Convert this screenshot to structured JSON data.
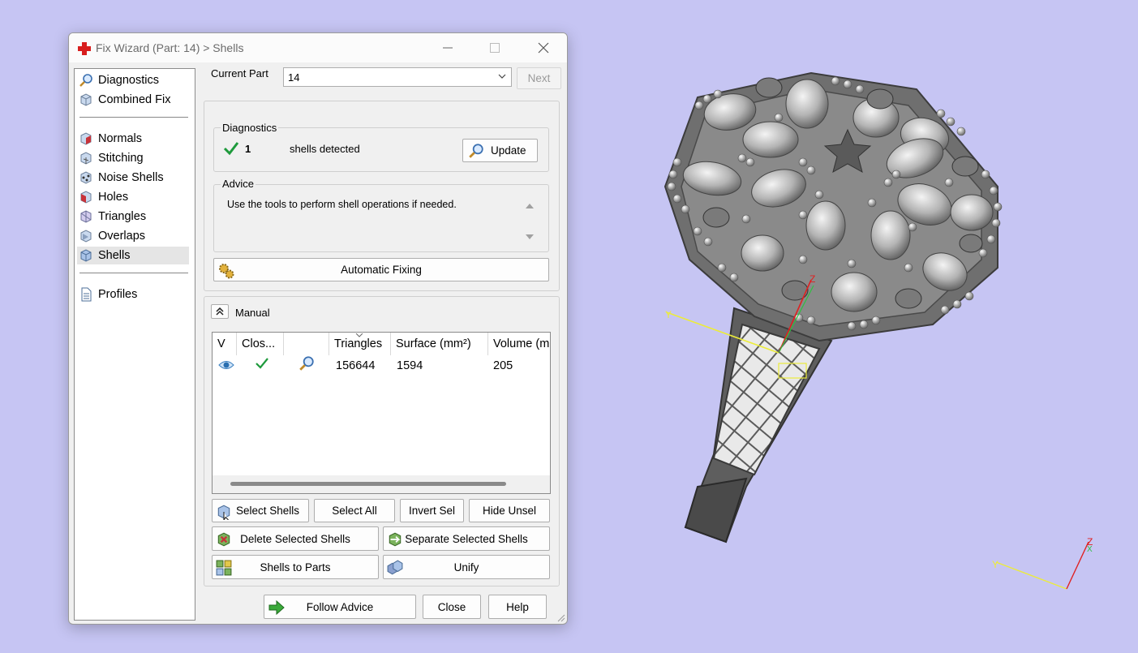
{
  "window": {
    "title": "Fix Wizard (Part: 14) > Shells",
    "controls": [
      "minimize-icon",
      "maximize-icon",
      "close-icon"
    ]
  },
  "sidebar": {
    "items": [
      {
        "label": "Diagnostics",
        "icon": "magnifier-icon"
      },
      {
        "label": "Combined Fix",
        "icon": "cube-icon"
      },
      {
        "label": "Normals",
        "icon": "normals-cube-icon"
      },
      {
        "label": "Stitching",
        "icon": "stitching-cube-icon"
      },
      {
        "label": "Noise Shells",
        "icon": "noise-cube-icon"
      },
      {
        "label": "Holes",
        "icon": "holes-cube-icon"
      },
      {
        "label": "Triangles",
        "icon": "triangles-cube-icon"
      },
      {
        "label": "Overlaps",
        "icon": "overlaps-cube-icon"
      },
      {
        "label": "Shells",
        "icon": "shells-cube-icon",
        "selected": true
      },
      {
        "label": "Profiles",
        "icon": "document-icon"
      }
    ]
  },
  "part": {
    "label": "Current Part",
    "value": "14",
    "next_label": "Next"
  },
  "diagnostics": {
    "title": "Diagnostics",
    "count": "1",
    "text": "shells detected",
    "update_label": "Update",
    "status_color": "#1e9a3c"
  },
  "advice": {
    "title": "Advice",
    "text": "Use the tools to perform shell operations if needed."
  },
  "auto_fix_label": "Automatic Fixing",
  "manual": {
    "label": "Manual",
    "columns": [
      "V",
      "Clos...",
      "",
      "Triangles",
      "Surface (mm²)",
      "Volume (m"
    ],
    "rows": [
      {
        "visible": "eye-icon",
        "closed": "check-icon",
        "action": "magnifier-icon",
        "triangles": "156644",
        "surface": "1594",
        "volume": "205"
      }
    ]
  },
  "buttons": {
    "select_shells": "Select Shells",
    "select_all": "Select All",
    "invert_sel": "Invert Sel",
    "hide_unsel": "Hide Unsel",
    "delete_selected": "Delete Selected Shells",
    "separate_selected": "Separate Selected Shells",
    "shells_to_parts": "Shells to Parts",
    "unify": "Unify"
  },
  "footer": {
    "follow_advice": "Follow Advice",
    "close": "Close",
    "help": "Help"
  },
  "viewport": {
    "background": "#c6c5f3",
    "model": "ring-mesh",
    "axis_labels": {
      "y": "Y",
      "z": "Z",
      "x": "X"
    }
  }
}
